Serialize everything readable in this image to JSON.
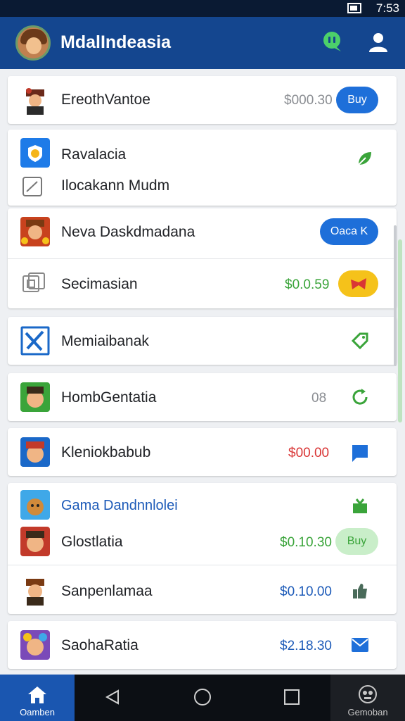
{
  "status_bar": {
    "time": "7:53"
  },
  "app_bar": {
    "title": "MdalIndeasia"
  },
  "items": [
    {
      "label": "EreothVantoe",
      "price": "$000.30",
      "action": "Buy"
    },
    {
      "label": "Ravalacia"
    },
    {
      "label": "Ilocakann Mudm"
    },
    {
      "label": "Neva Daskdmadana",
      "action": "Oaca K"
    },
    {
      "label": "Secimasian",
      "price": "$0.0.59"
    },
    {
      "label": "Memiaibanak"
    },
    {
      "label": "HombGentatia",
      "price": "08"
    },
    {
      "label": "Kleniokbabub",
      "price": "$00.00"
    },
    {
      "label": "Gama Dandnnlolei"
    },
    {
      "label": "Glostlatia",
      "price": "$0.10.30",
      "action": "Buy"
    },
    {
      "label": "Sanpenlamaa",
      "price": "$0.10.00"
    },
    {
      "label": "SaohaRatia",
      "price": "$2.18.30"
    }
  ],
  "bottom_nav": {
    "home_label": "Oamben",
    "games_label": "Gemoban"
  },
  "colors": {
    "primary": "#14468f",
    "accent_blue": "#1e6fd9",
    "price_gray": "#8a8d92",
    "price_green": "#3aa43a",
    "price_red": "#d93535",
    "price_blue": "#1c5ab8",
    "warning": "#f5c21a"
  }
}
